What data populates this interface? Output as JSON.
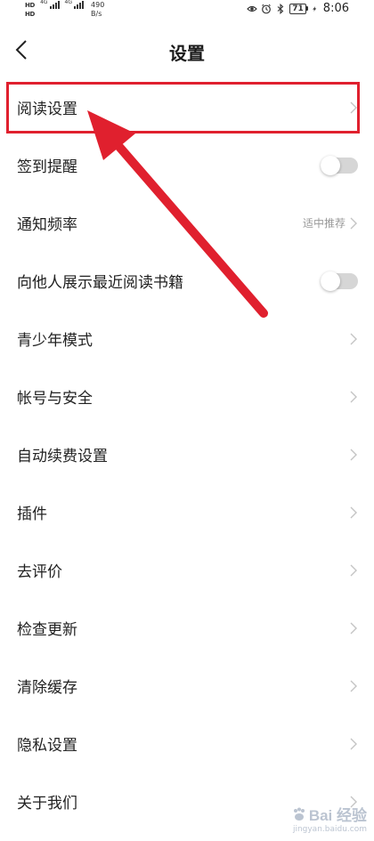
{
  "status_bar": {
    "hd_badges": [
      "HD",
      "HD"
    ],
    "network_labels": [
      "4G",
      "4G"
    ],
    "speed_value": "490",
    "speed_unit": "B/s",
    "battery_level": "71",
    "time": "8:06",
    "icons": [
      "eye-icon",
      "alarm-icon",
      "bluetooth-icon",
      "battery-icon",
      "charging-icon"
    ]
  },
  "nav": {
    "title": "设置",
    "back_icon": "back-chevron-icon"
  },
  "settings": [
    {
      "label": "阅读设置",
      "control": "chevron",
      "value": ""
    },
    {
      "label": "签到提醒",
      "control": "toggle",
      "on": false
    },
    {
      "label": "通知频率",
      "control": "chevron",
      "value": "适中推荐"
    },
    {
      "label": "向他人展示最近阅读书籍",
      "control": "toggle",
      "on": false
    },
    {
      "label": "青少年模式",
      "control": "chevron",
      "value": ""
    },
    {
      "label": "帐号与安全",
      "control": "chevron",
      "value": ""
    },
    {
      "label": "自动续费设置",
      "control": "chevron",
      "value": ""
    },
    {
      "label": "插件",
      "control": "chevron",
      "value": ""
    },
    {
      "label": "去评价",
      "control": "chevron",
      "value": ""
    },
    {
      "label": "检查更新",
      "control": "chevron",
      "value": ""
    },
    {
      "label": "清除缓存",
      "control": "chevron",
      "value": ""
    },
    {
      "label": "隐私设置",
      "control": "chevron",
      "value": ""
    },
    {
      "label": "关于我们",
      "control": "chevron",
      "value": ""
    }
  ],
  "annotation": {
    "color": "#e0202e",
    "highlighted_item": "阅读设置"
  },
  "watermark": {
    "text": "Bai 经验",
    "sub": "jingyan.baidu.com"
  }
}
